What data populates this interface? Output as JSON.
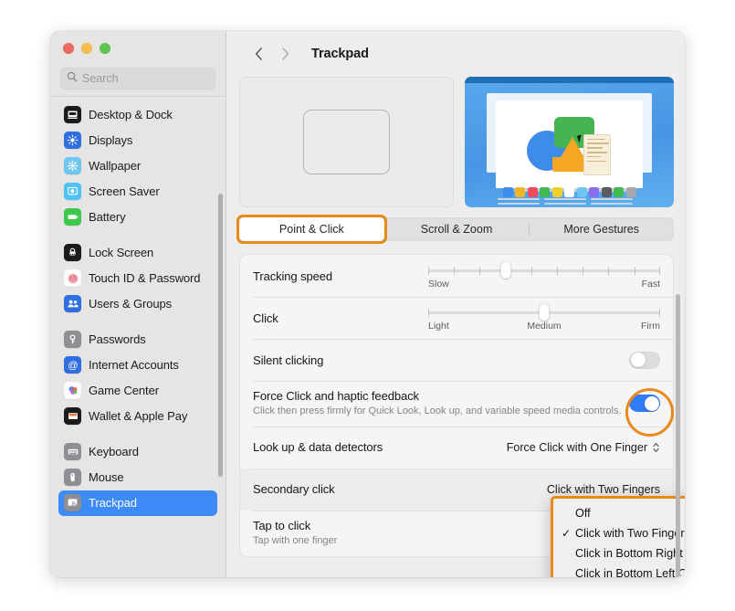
{
  "window": {
    "traffic_lights": [
      "close",
      "minimize",
      "zoom"
    ],
    "colors": {
      "red": "#ec6a5f",
      "yellow": "#f4bf4f",
      "green": "#61c554",
      "accent_blue": "#3d8bf8",
      "highlight_orange": "#e8891a"
    }
  },
  "search": {
    "placeholder": "Search",
    "value": "",
    "icon": "search-icon"
  },
  "sidebar": {
    "groups": [
      {
        "items": [
          {
            "label": "Desktop & Dock",
            "icon": "desktop-dock-icon"
          },
          {
            "label": "Displays",
            "icon": "displays-icon"
          },
          {
            "label": "Wallpaper",
            "icon": "wallpaper-icon"
          },
          {
            "label": "Screen Saver",
            "icon": "screen-saver-icon"
          },
          {
            "label": "Battery",
            "icon": "battery-icon"
          }
        ]
      },
      {
        "items": [
          {
            "label": "Lock Screen",
            "icon": "lock-screen-icon"
          },
          {
            "label": "Touch ID & Password",
            "icon": "touch-id-icon"
          },
          {
            "label": "Users & Groups",
            "icon": "users-groups-icon"
          }
        ]
      },
      {
        "items": [
          {
            "label": "Passwords",
            "icon": "passwords-key-icon"
          },
          {
            "label": "Internet Accounts",
            "icon": "internet-accounts-icon"
          },
          {
            "label": "Game Center",
            "icon": "game-center-icon"
          },
          {
            "label": "Wallet & Apple Pay",
            "icon": "wallet-icon"
          }
        ]
      },
      {
        "items": [
          {
            "label": "Keyboard",
            "icon": "keyboard-icon"
          },
          {
            "label": "Mouse",
            "icon": "mouse-icon"
          },
          {
            "label": "Trackpad",
            "icon": "trackpad-icon",
            "selected": true
          }
        ]
      }
    ]
  },
  "toolbar": {
    "back_icon": "chevron-left-icon",
    "forward_icon": "chevron-right-icon",
    "title": "Trackpad"
  },
  "preview": {
    "trackpad_shape": "trackpad-outline",
    "demo_video": "point-and-click-demo",
    "dot_colors": [
      "#3d8ce8",
      "#f5b423",
      "#ee4b5c",
      "#3fb950",
      "#f2d02c",
      "#ffffff",
      "#6fc6f2",
      "#8a6ef0",
      "#5b5b5f",
      "#3fb950",
      "#a8a8ac"
    ]
  },
  "tabs": [
    {
      "label": "Point & Click",
      "active": true,
      "highlighted": true
    },
    {
      "label": "Scroll & Zoom",
      "active": false
    },
    {
      "label": "More Gestures",
      "active": false
    }
  ],
  "settings": [
    {
      "id": "tracking-speed",
      "label": "Tracking speed",
      "control": "slider",
      "ticks": 10,
      "value_index": 3,
      "min_label": "Slow",
      "max_label": "Fast"
    },
    {
      "id": "click",
      "label": "Click",
      "control": "slider-continuous",
      "value_percent": 50,
      "min_label": "Light",
      "mid_label": "Medium",
      "max_label": "Firm"
    },
    {
      "id": "silent-clicking",
      "label": "Silent clicking",
      "control": "toggle",
      "value": "off"
    },
    {
      "id": "force-click",
      "label": "Force Click and haptic feedback",
      "sublabel": "Click then press firmly for Quick Look, Look up, and variable speed media controls.",
      "control": "toggle",
      "value": "on",
      "highlighted": true
    },
    {
      "id": "look-up-data-detectors",
      "label": "Look up & data detectors",
      "control": "popup",
      "value": "Force Click with One Finger"
    },
    {
      "id": "secondary-click",
      "label": "Secondary click",
      "control": "popup",
      "value": "Click with Two Fingers",
      "shaded": true
    },
    {
      "id": "tap-to-click",
      "label": "Tap to click",
      "sublabel": "Tap with one finger",
      "control": "toggle",
      "value": "off"
    }
  ],
  "dropdown": {
    "open_for": "secondary-click",
    "highlighted": true,
    "items": [
      {
        "label": "Off",
        "checked": false
      },
      {
        "label": "Click with Two Fingers",
        "checked": true
      },
      {
        "label": "Click in Bottom Right Corner",
        "checked": false
      },
      {
        "label": "Click in Bottom Left Corner",
        "checked": false
      }
    ],
    "check_glyph": "✓"
  }
}
